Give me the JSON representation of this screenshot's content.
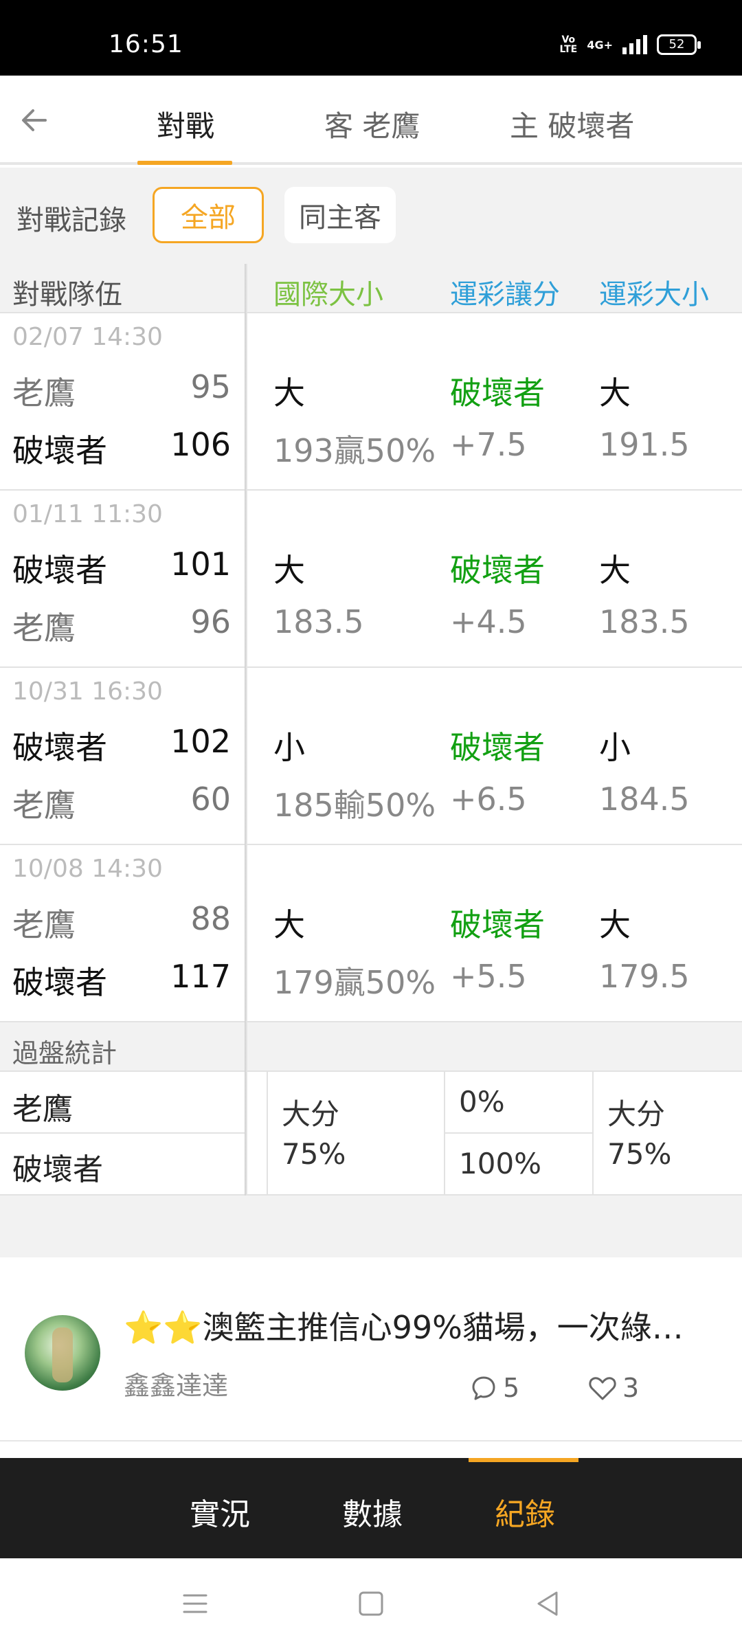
{
  "status_bar": {
    "time": "16:51",
    "volte": "Vo LTE",
    "network": "4G+",
    "battery": "52"
  },
  "header": {
    "tabs": [
      {
        "label": "對戰"
      },
      {
        "label": "客 老鷹"
      },
      {
        "label": "主 破壞者"
      }
    ]
  },
  "filter": {
    "label": "對戰記錄",
    "chips": [
      {
        "label": "全部"
      },
      {
        "label": "同主客"
      }
    ]
  },
  "table": {
    "headers": {
      "teams": "對戰隊伍",
      "intl_ou": "國際大小",
      "spread": "運彩讓分",
      "lottery_ou": "運彩大小"
    },
    "matches": [
      {
        "date": "02/07 14:30",
        "team1": "老鷹",
        "score1": "95",
        "team2": "破壞者",
        "score2": "106",
        "intl_result": "大",
        "intl_line": "193贏50%",
        "spread_team": "破壞者",
        "spread_line": "+7.5",
        "ou_result": "大",
        "ou_line": "191.5"
      },
      {
        "date": "01/11 11:30",
        "team1": "破壞者",
        "score1": "101",
        "team2": "老鷹",
        "score2": "96",
        "intl_result": "大",
        "intl_line": "183.5",
        "spread_team": "破壞者",
        "spread_line": "+4.5",
        "ou_result": "大",
        "ou_line": "183.5"
      },
      {
        "date": "10/31 16:30",
        "team1": "破壞者",
        "score1": "102",
        "team2": "老鷹",
        "score2": "60",
        "intl_result": "小",
        "intl_line": "185輸50%",
        "spread_team": "破壞者",
        "spread_line": "+6.5",
        "ou_result": "小",
        "ou_line": "184.5"
      },
      {
        "date": "10/08 14:30",
        "team1": "老鷹",
        "score1": "88",
        "team2": "破壞者",
        "score2": "117",
        "intl_result": "大",
        "intl_line": "179贏50%",
        "spread_team": "破壞者",
        "spread_line": "+5.5",
        "ou_result": "大",
        "ou_line": "179.5"
      }
    ]
  },
  "stats": {
    "label": "過盤統計",
    "team1": "老鷹",
    "team2": "破壞者",
    "intl_label": "大分",
    "intl_pct": "75%",
    "spread_team1_pct": "0%",
    "spread_team2_pct": "100%",
    "lottery_label": "大分",
    "lottery_pct": "75%"
  },
  "post": {
    "stars": "⭐⭐",
    "title": "澳籃主推信心99%貓場，一次綠…",
    "author": "鑫鑫達達",
    "comments": "5",
    "likes": "3"
  },
  "bottom_nav": {
    "items": [
      {
        "label": "實況"
      },
      {
        "label": "數據"
      },
      {
        "label": "紀錄"
      }
    ]
  },
  "colors": {
    "accent": "#f5a623",
    "green": "#12a012",
    "blue": "#2f9fd8",
    "light_green": "#7cc242"
  }
}
